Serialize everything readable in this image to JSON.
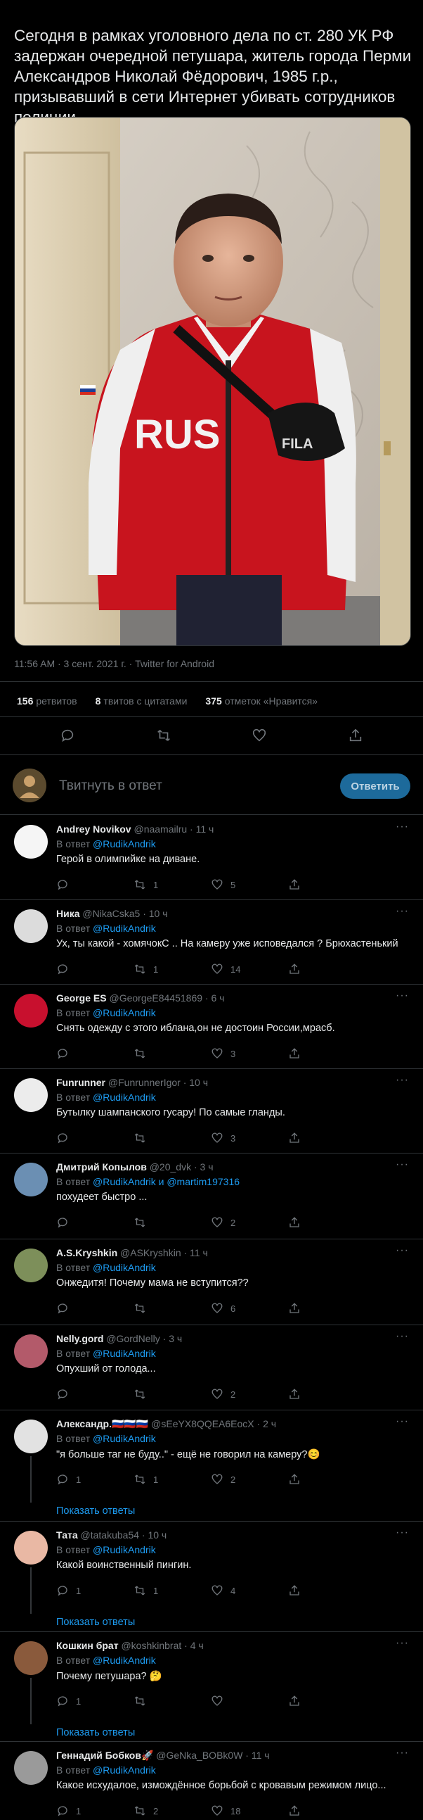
{
  "tweet": {
    "text": "Сегодня в рамках уголовного дела по ст. 280 УК РФ задержан очередной петушара, житель города Перми Александров Николай Фёдорович, 1985 г.р., призывавший в сети Интернет убивать сотрудников полиции.",
    "photo_print": "RUS",
    "photo_bag_brand": "FILA",
    "meta": "11:56 AM · 3 сент. 2021 г. · Twitter for Android",
    "retweets_count": "156",
    "retweets_label": "ретвитов",
    "quotes_count": "8",
    "quotes_label": "твитов с цитатами",
    "likes_count": "375",
    "likes_label": "отметок «Нравится»"
  },
  "compose": {
    "placeholder": "Твитнуть в ответ",
    "button_label": "Ответить"
  },
  "colors": {
    "accent": "#1d9bf0",
    "muted": "#71767b",
    "divider": "#2f3336",
    "button": "#1d6a9b"
  },
  "replies": [
    {
      "name": "Andrey Novikov",
      "handle_time": "@naamailru · 11 ч",
      "reply_to_prefix": "В ответ",
      "reply_to": "@RudikAndrik",
      "reply_to_extra": "",
      "text": "Герой в олимпийке на диване.",
      "replies": "",
      "retweets": "1",
      "likes": "5",
      "show_replies": "",
      "avatar_color": "#f5f5f5"
    },
    {
      "name": "Ника",
      "handle_time": "@NikaCska5 · 10 ч",
      "reply_to_prefix": "В ответ",
      "reply_to": "@RudikAndrik",
      "reply_to_extra": "",
      "text": "Ух, ты  какой - хомячокС .. На камеру уже исповедался ? Брюхастенький",
      "replies": "",
      "retweets": "1",
      "likes": "14",
      "show_replies": "",
      "avatar_color": "#dcdcdc"
    },
    {
      "name": "George ES",
      "handle_time": "@GeorgeE84451869 · 6 ч",
      "reply_to_prefix": "В ответ",
      "reply_to": "@RudikAndrik",
      "reply_to_extra": "",
      "text": "Снять одежду с этого иблана,он не достоин России,мрасб.",
      "replies": "",
      "retweets": "",
      "likes": "3",
      "show_replies": "",
      "avatar_color": "#c8102e"
    },
    {
      "name": "Funrunner",
      "handle_time": "@FunrunnerIgor · 10 ч",
      "reply_to_prefix": "В ответ",
      "reply_to": "@RudikAndrik",
      "reply_to_extra": "",
      "text": "Бутылку шампанского гусару! По самые гланды.",
      "replies": "",
      "retweets": "",
      "likes": "3",
      "show_replies": "",
      "avatar_color": "#ececec"
    },
    {
      "name": "Дмитрий Копылов",
      "handle_time": "@20_dvk · 3 ч",
      "reply_to_prefix": "В ответ",
      "reply_to": "@RudikAndrik",
      "reply_to_extra": "и @martim197316",
      "text": "похудеет быстро ...",
      "replies": "",
      "retweets": "",
      "likes": "2",
      "show_replies": "",
      "avatar_color": "#6b8fb3"
    },
    {
      "name": "A.S.Kryshkin",
      "handle_time": "@ASKryshkin · 11 ч",
      "reply_to_prefix": "В ответ",
      "reply_to": "@RudikAndrik",
      "reply_to_extra": "",
      "text": "Онжедитя! Почему мама не вступится??",
      "replies": "",
      "retweets": "",
      "likes": "6",
      "show_replies": "",
      "avatar_color": "#7d8f5a"
    },
    {
      "name": "Nelly.gord",
      "handle_time": "@GordNelly · 3 ч",
      "reply_to_prefix": "В ответ",
      "reply_to": "@RudikAndrik",
      "reply_to_extra": "",
      "text": "Опухший от голода...",
      "replies": "",
      "retweets": "",
      "likes": "2",
      "show_replies": "",
      "avatar_color": "#b35a6a"
    },
    {
      "name": "Александр.🇷🇺🇷🇺🇷🇺",
      "handle_time": "@sEeYX8QQEA6EocX · 2 ч",
      "reply_to_prefix": "В ответ",
      "reply_to": "@RudikAndrik",
      "reply_to_extra": "",
      "text": "\"я больше таг не буду..\" - ещё не говорил на камеру?😊",
      "replies": "1",
      "retweets": "1",
      "likes": "2",
      "show_replies": "Показать ответы",
      "avatar_color": "#e2e2e2"
    },
    {
      "name": "Тата",
      "handle_time": "@tatakuba54 · 10 ч",
      "reply_to_prefix": "В ответ",
      "reply_to": "@RudikAndrik",
      "reply_to_extra": "",
      "text": "Какой воинственный пингин.",
      "replies": "1",
      "retweets": "1",
      "likes": "4",
      "show_replies": "Показать ответы",
      "avatar_color": "#e9b8a4"
    },
    {
      "name": "Кошкин брат",
      "handle_time": "@koshkinbrat · 4 ч",
      "reply_to_prefix": "В ответ",
      "reply_to": "@RudikAndrik",
      "reply_to_extra": "",
      "text": "Почему петушара? 🤔",
      "replies": "1",
      "retweets": "",
      "likes": "",
      "show_replies": "Показать ответы",
      "avatar_color": "#8a5a3c"
    },
    {
      "name": "Геннадий Бобков🚀",
      "handle_time": "@GeNka_BOBk0W · 11 ч",
      "reply_to_prefix": "В ответ",
      "reply_to": "@RudikAndrik",
      "reply_to_extra": "",
      "text": "Какое исхудалое, измождённое борьбой с кровавым режимом лицо...",
      "replies": "1",
      "retweets": "2",
      "likes": "18",
      "show_replies": "",
      "avatar_color": "#9a9a9a"
    }
  ]
}
